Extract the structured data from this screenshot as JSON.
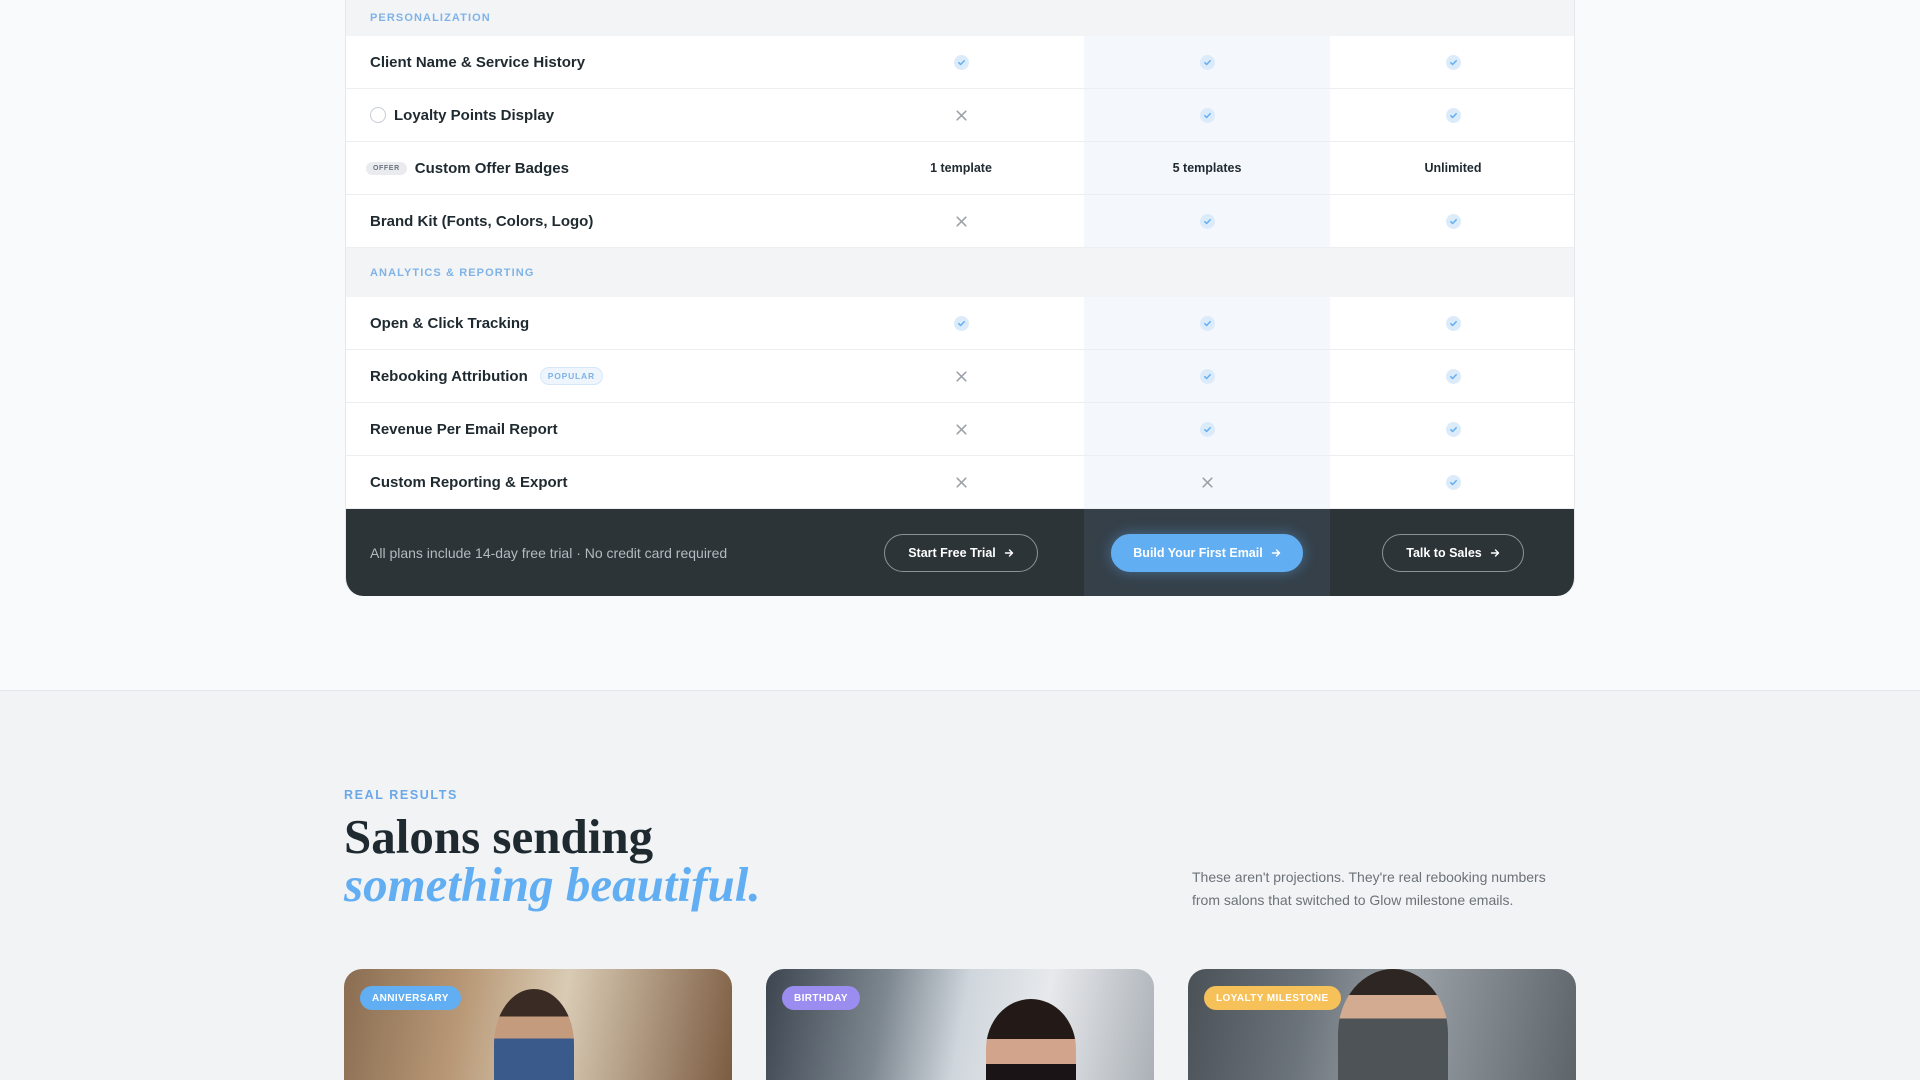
{
  "colors": {
    "accent": "#62aef2",
    "section_label": "#7fb3e6",
    "footer_bg": "#2c3438",
    "birthday": "#9b8cf0",
    "loyalty": "#f7c15a"
  },
  "sections": [
    {
      "label": "PERSONALIZATION",
      "rows": [
        {
          "feature": "Client Name & Service History",
          "icon": null,
          "values": [
            "check",
            "check",
            "check"
          ]
        },
        {
          "feature": "Loyalty Points Display",
          "icon": "circle-icon",
          "values": [
            "cross",
            "check",
            "check"
          ]
        },
        {
          "feature": "Custom Offer Badges",
          "chip": "OFFER",
          "values": [
            "1 template",
            "5 templates",
            "Unlimited"
          ]
        },
        {
          "feature": "Brand Kit (Fonts, Colors, Logo)",
          "values": [
            "cross",
            "check",
            "check"
          ]
        }
      ]
    },
    {
      "label": "ANALYTICS & REPORTING",
      "rows": [
        {
          "feature": "Open & Click Tracking",
          "values": [
            "check",
            "check",
            "check"
          ]
        },
        {
          "feature": "Rebooking Attribution",
          "tag": "POPULAR",
          "values": [
            "cross",
            "check",
            "check"
          ]
        },
        {
          "feature": "Revenue Per Email Report",
          "values": [
            "cross",
            "check",
            "check"
          ]
        },
        {
          "feature": "Custom Reporting & Export",
          "values": [
            "cross",
            "cross",
            "check"
          ]
        }
      ]
    }
  ],
  "footer": {
    "note": "All plans include 14-day free trial · No credit card required",
    "trial_label": "Start Free Trial",
    "build_label": "Build Your First Email",
    "sales_label": "Talk to Sales"
  },
  "results": {
    "eyebrow": "REAL RESULTS",
    "headline_line1": "Salons sending",
    "headline_line2": "something beautiful.",
    "intro": "These aren't projections. They're real rebooking numbers from salons that switched to Glow milestone emails.",
    "cards": [
      {
        "badge": "ANNIVERSARY"
      },
      {
        "badge": "BIRTHDAY"
      },
      {
        "badge": "LOYALTY MILESTONE"
      }
    ]
  }
}
